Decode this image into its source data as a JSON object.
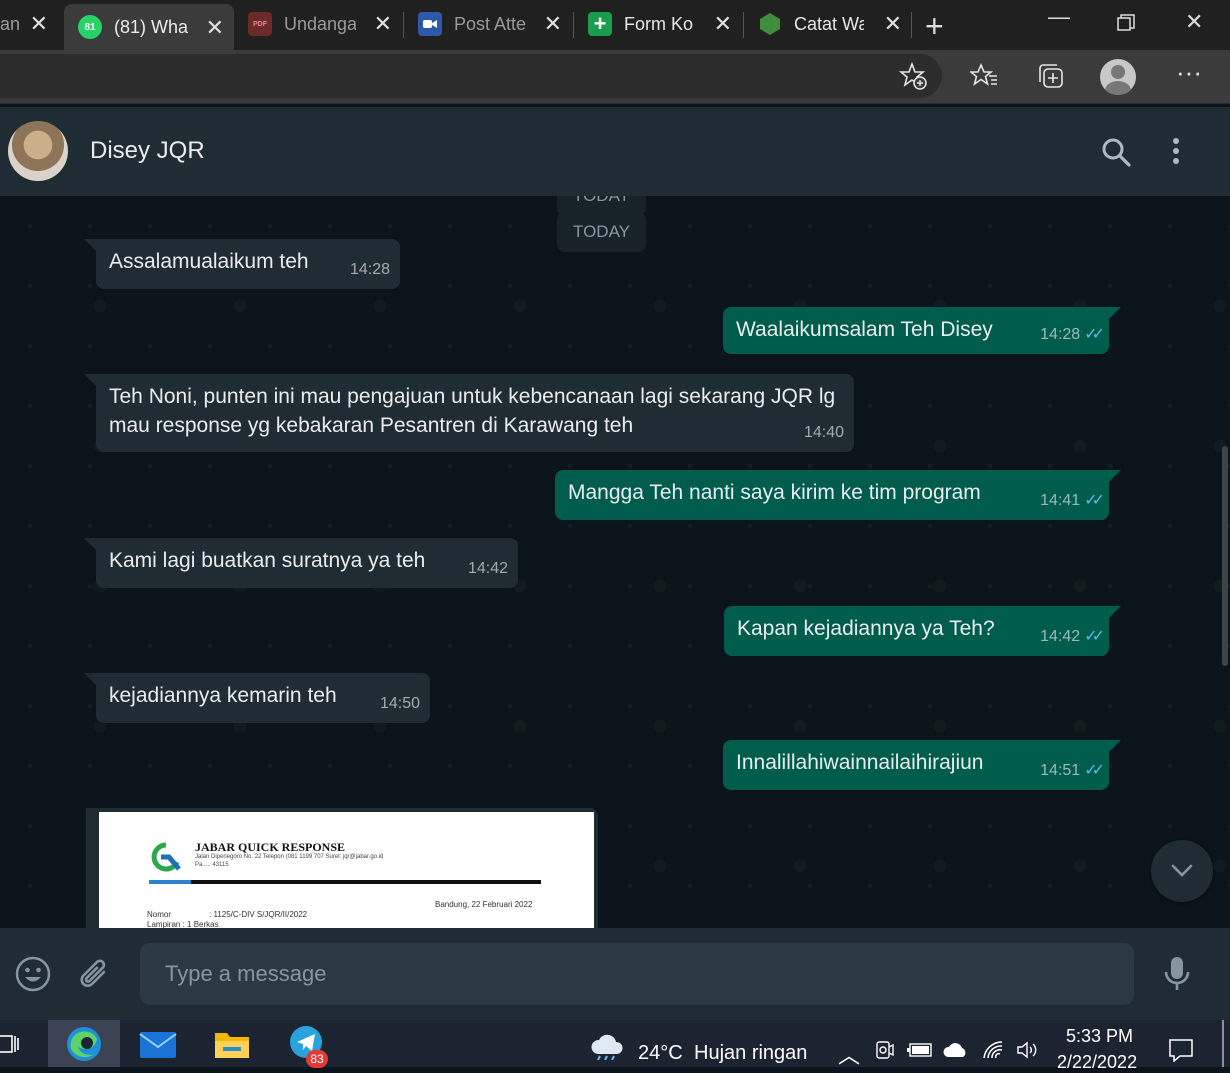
{
  "browser": {
    "tabs": [
      {
        "title": "an",
        "favicon": "generic-favicon"
      },
      {
        "title": "(81) Wha",
        "favicon": "whatsapp-icon",
        "badge": "81",
        "active": true
      },
      {
        "title": "Undanga",
        "favicon": "pdf-icon",
        "badge": "PDF"
      },
      {
        "title": "Post Atte",
        "favicon": "zoom-icon"
      },
      {
        "title": "Form Ko",
        "favicon": "google-forms-icon"
      },
      {
        "title": "Catat Wa",
        "favicon": "nodejs-icon"
      }
    ],
    "toolbar_icons": [
      "add-favorite-icon",
      "favorites-icon",
      "collections-icon",
      "profile-icon",
      "more-icon"
    ]
  },
  "chat": {
    "contact_name": "Disey JQR",
    "date_label_partial": "TODAY",
    "date_label": "TODAY",
    "messages": [
      {
        "dir": "in",
        "text": "Assalamualaikum teh",
        "time": "14:28"
      },
      {
        "dir": "out",
        "text": "Waalaikumsalam Teh Disey",
        "time": "14:28",
        "ticks": "✓✓"
      },
      {
        "dir": "in",
        "text": "Teh Noni, punten ini mau pengajuan untuk kebencanaan lagi  sekarang JQR lg mau response yg kebakaran Pesantren di Karawang teh",
        "time": "14:40"
      },
      {
        "dir": "out",
        "text": "Mangga Teh nanti saya kirim ke tim program",
        "time": "14:41",
        "ticks": "✓✓"
      },
      {
        "dir": "in",
        "text": "Kami lagi buatkan suratnya ya teh",
        "time": "14:42"
      },
      {
        "dir": "out",
        "text": "Kapan kejadiannya ya Teh?",
        "time": "14:42",
        "ticks": "✓✓"
      },
      {
        "dir": "in",
        "text": "kejadiannya kemarin teh",
        "time": "14:50"
      },
      {
        "dir": "out",
        "text": "Innalillahiwainnailaihirajiun",
        "time": "14:51",
        "ticks": "✓✓"
      }
    ],
    "document": {
      "org": "JABAR QUICK RESPONSE",
      "address_line1": "Jalan Dipenegoro No. 22 Telepon (081 1199 707  Surel: jqr@jabar.go.id",
      "address_line2": "Pa..... 43115",
      "date": "Bandung, 22 Februari 2022",
      "nomor_label": "Nomor",
      "nomor_value": ": 1125/C-DIV  S/JQR/II/2022",
      "lampiran": "Lampiran   : 1 Berkas"
    }
  },
  "composer": {
    "placeholder": "Type a message"
  },
  "taskbar": {
    "apps": [
      "task-view-icon",
      "edge-icon",
      "mail-icon",
      "file-explorer-icon",
      "telegram-icon"
    ],
    "telegram_badge": "83",
    "weather_temp": "24°C",
    "weather_desc": "Hujan ringan",
    "time": "5:33 PM",
    "date": "2/22/2022"
  }
}
